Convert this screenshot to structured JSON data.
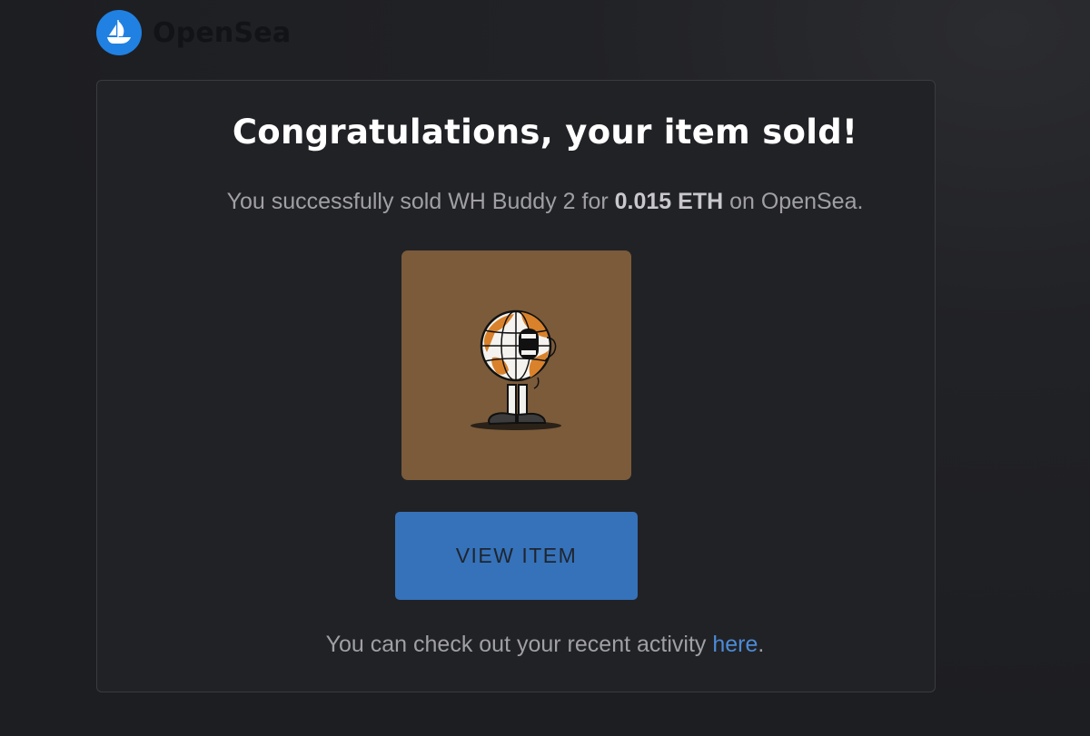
{
  "brand": {
    "name": "OpenSea",
    "accent_color": "#2081e2"
  },
  "email": {
    "headline": "Congratulations, your item sold!",
    "sold_prefix": "You successfully sold WH Buddy 2 for ",
    "sold_price": "0.015 ETH",
    "sold_suffix": " on OpenSea.",
    "view_button_label": "VIEW ITEM",
    "activity_prefix": "You can check out your recent activity ",
    "activity_link_label": "here",
    "activity_suffix": "."
  },
  "item": {
    "image_icon": "globe-character-nft"
  }
}
